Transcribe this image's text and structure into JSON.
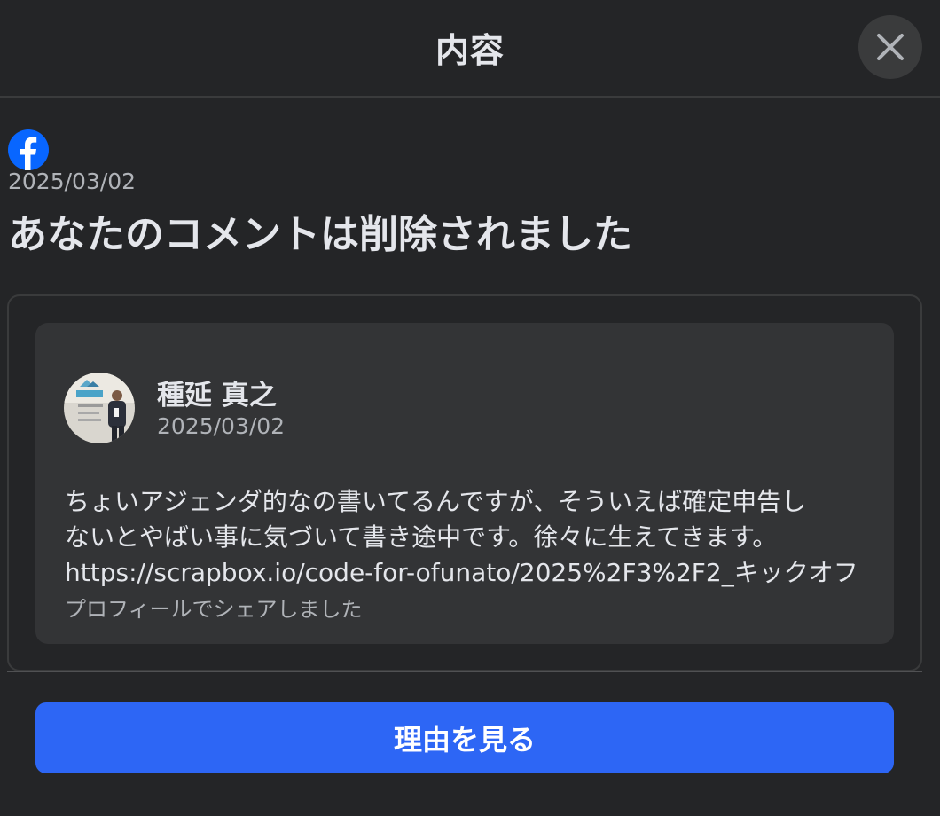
{
  "header": {
    "title": "内容",
    "close_icon": "close-icon"
  },
  "notice": {
    "platform_icon": "facebook-logo-icon",
    "date": "2025/03/02",
    "headline": "あなたのコメントは削除されました"
  },
  "post": {
    "author_name": "種延 真之",
    "date": "2025/03/02",
    "body_lines": [
      "ちょいアジェンダ的なの書いてるんですが、そういえば確定申告し",
      "ないとやばい事に気づいて書き途中です。徐々に生えてきます。",
      "https://scrapbox.io/code-for-ofunato/2025%2F3%2F2_キックオフ"
    ],
    "source": "プロフィールでシェアしました"
  },
  "actions": {
    "reason_button": "理由を見る"
  },
  "colors": {
    "background": "#242527",
    "card": "#333436",
    "accent_button": "#2d66f5",
    "facebook_blue": "#0866ff"
  }
}
